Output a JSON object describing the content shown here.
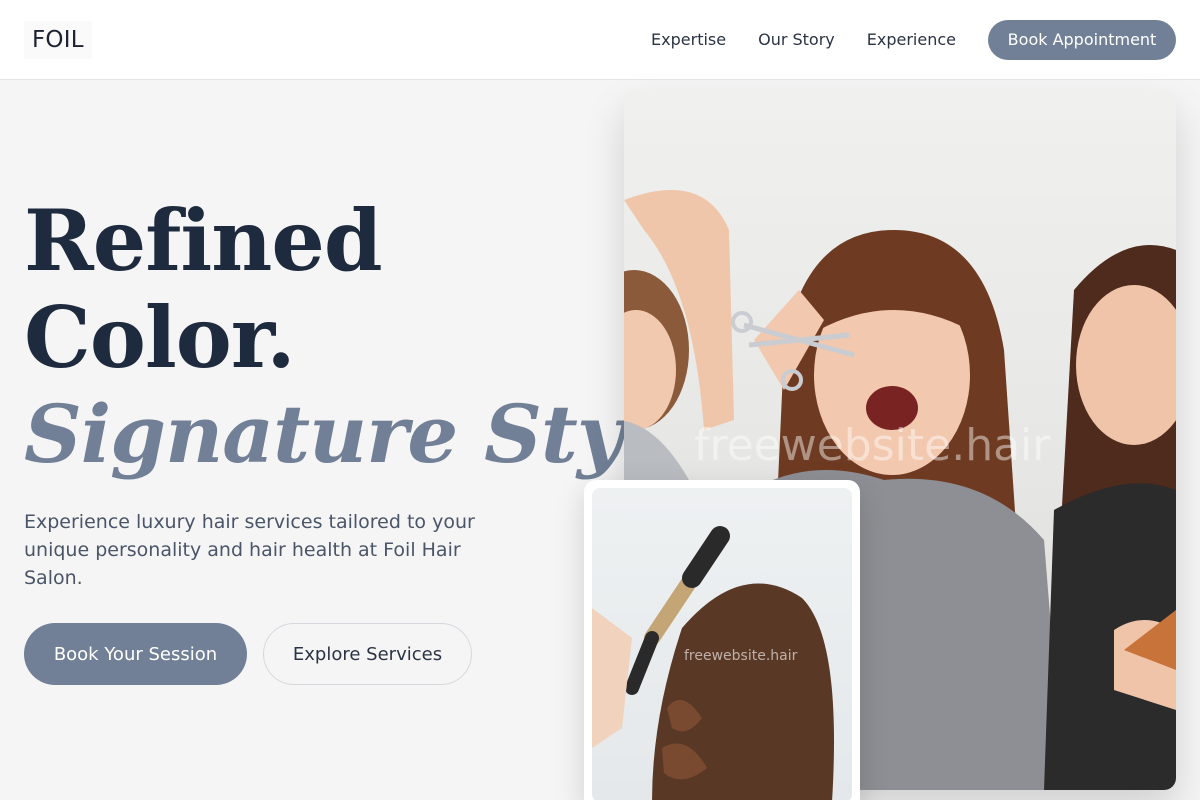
{
  "header": {
    "logo": "FOIL",
    "nav": [
      "Expertise",
      "Our Story",
      "Experience"
    ],
    "cta": "Book Appointment"
  },
  "hero": {
    "title_line1": "Refined",
    "title_line2": "Color.",
    "title_line3": "Signature Style.",
    "description": "Experience luxury hair services tailored to your unique personality and hair health at Foil Hair Salon.",
    "primary_button": "Book Your Session",
    "secondary_button": "Explore Services"
  },
  "images": {
    "main_watermark": "freewebsite.hair",
    "sub_watermark": "freewebsite.hair"
  },
  "colors": {
    "accent": "#718096",
    "heading": "#1e2a3e",
    "background": "#f5f5f5"
  }
}
